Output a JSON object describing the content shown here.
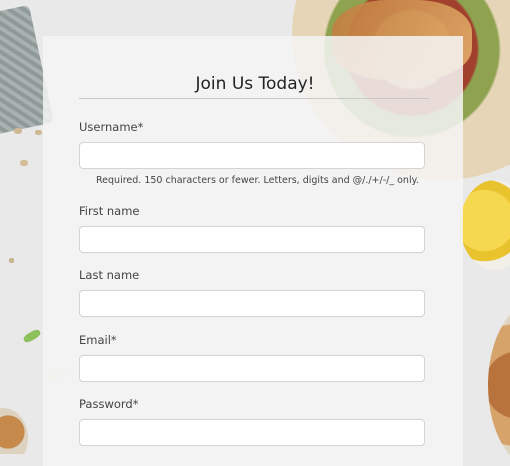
{
  "form": {
    "title": "Join Us Today!",
    "fields": [
      {
        "label": "Username*",
        "value": "",
        "placeholder": ""
      },
      {
        "label": "First name",
        "value": "",
        "placeholder": ""
      },
      {
        "label": "Last name",
        "value": "",
        "placeholder": ""
      },
      {
        "label": "Email*",
        "value": "",
        "placeholder": ""
      },
      {
        "label": "Password*",
        "value": "",
        "placeholder": ""
      }
    ],
    "username_help": "Required. 150 characters or fewer. Letters, digits and @/./+/-/_ only."
  },
  "colors": {
    "card_background": "#f5f5f5",
    "input_border": "#d4d4d4",
    "text": "#444444"
  }
}
